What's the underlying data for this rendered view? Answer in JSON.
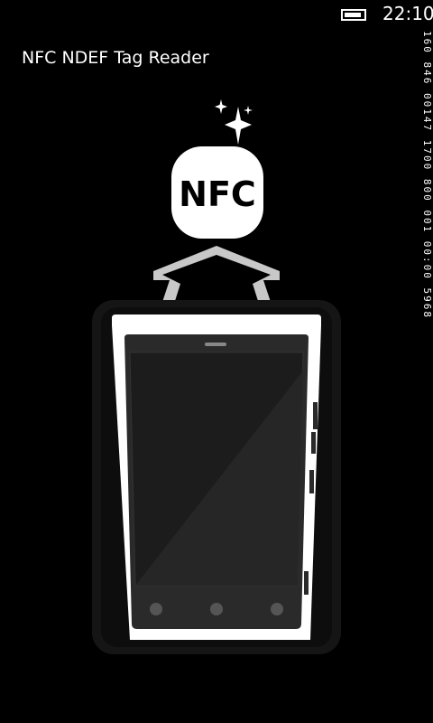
{
  "status_bar": {
    "time": "22:10",
    "battery_icon": "battery-full-icon"
  },
  "app": {
    "title": "NFC NDEF Tag Reader"
  },
  "debug_counter": "160 846 00147 1700 800 001 00:00 5968",
  "illustration": {
    "badge_text": "NFC",
    "sparkle_icon": "sparkle-icon",
    "phone_icon": "phone-icon",
    "colors": {
      "background": "#000000",
      "badge": "#ffffff",
      "badge_text": "#000000",
      "phone_frame": "#ffffff",
      "screen": "#1e1e1e",
      "arrow": "#c8c8c8"
    }
  }
}
